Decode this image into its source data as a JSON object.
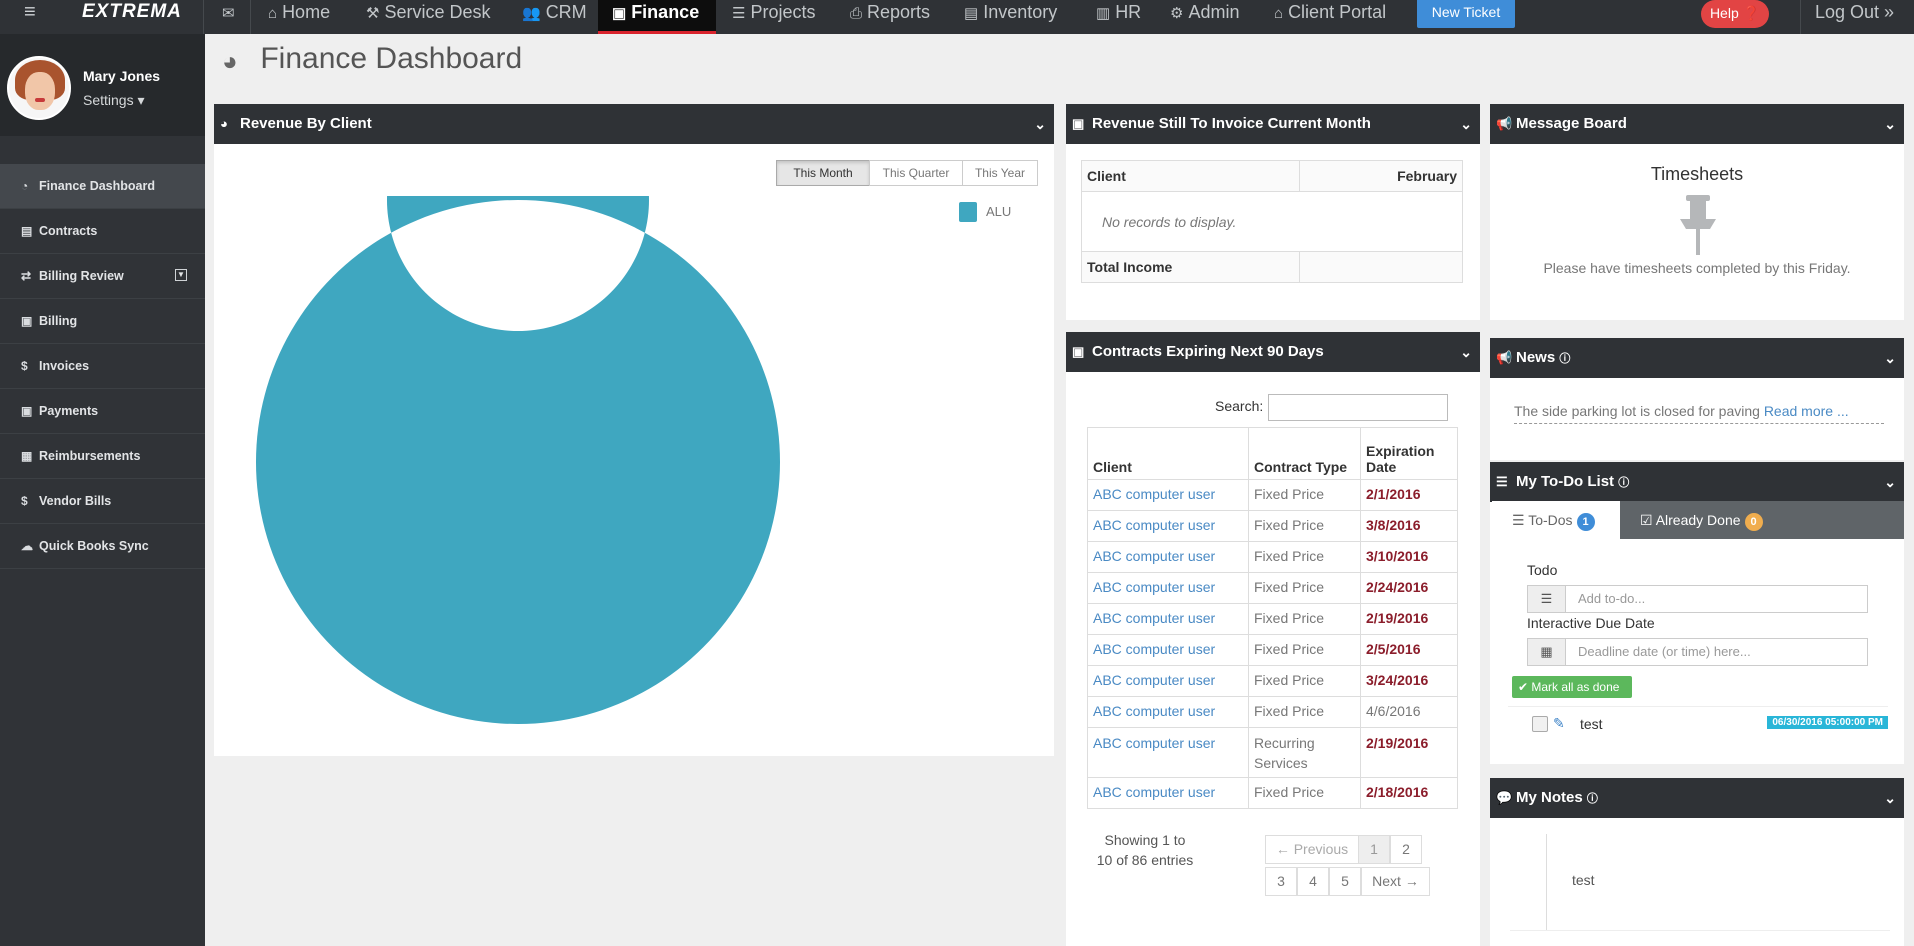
{
  "topnav": {
    "logo": "EXTREMA",
    "items": [
      {
        "label": "",
        "icon": "envelope-icon",
        "glyph": "✉"
      },
      {
        "label": "Home",
        "icon": "home-icon",
        "glyph": "⌂"
      },
      {
        "label": "Service Desk",
        "icon": "wrench-icon",
        "glyph": "⚒"
      },
      {
        "label": "CRM",
        "icon": "users-icon",
        "glyph": "👥"
      },
      {
        "label": "Finance",
        "icon": "money-icon",
        "glyph": "▣"
      },
      {
        "label": "Projects",
        "icon": "tasks-icon",
        "glyph": "☰"
      },
      {
        "label": "Reports",
        "icon": "print-icon",
        "glyph": "⎙"
      },
      {
        "label": "Inventory",
        "icon": "file-icon",
        "glyph": "▤"
      },
      {
        "label": "HR",
        "icon": "briefcase-icon",
        "glyph": "▥"
      },
      {
        "label": "Admin",
        "icon": "gear-icon",
        "glyph": "⚙"
      },
      {
        "label": "Client Portal",
        "icon": "home-icon",
        "glyph": "⌂"
      }
    ],
    "new_ticket": "New Ticket",
    "help": "Help ❓",
    "logout": "Log Out »"
  },
  "user": {
    "name": "Mary Jones",
    "settings": "Settings ▾"
  },
  "sidebar": {
    "items": [
      {
        "label": "Finance Dashboard",
        "icon": "dashboard-icon",
        "glyph": "◔"
      },
      {
        "label": "Contracts",
        "icon": "book-icon",
        "glyph": "▤"
      },
      {
        "label": "Billing Review",
        "icon": "retweet-icon",
        "glyph": "⇄"
      },
      {
        "label": "Billing",
        "icon": "money-icon",
        "glyph": "▣"
      },
      {
        "label": "Invoices",
        "icon": "dollar-icon",
        "glyph": "$"
      },
      {
        "label": "Payments",
        "icon": "money-icon",
        "glyph": "▣"
      },
      {
        "label": "Reimbursements",
        "icon": "calculator-icon",
        "glyph": "▦"
      },
      {
        "label": "Vendor Bills",
        "icon": "dollar-icon",
        "glyph": "$"
      },
      {
        "label": "Quick Books Sync",
        "icon": "cloud-upload-icon",
        "glyph": "☁"
      }
    ]
  },
  "page": {
    "title": "Finance Dashboard"
  },
  "revenue_by_client": {
    "title": "Revenue By Client",
    "tabs": [
      "This Month",
      "This Quarter",
      "This Year"
    ],
    "legend": "ALU"
  },
  "chart_data": {
    "type": "pie",
    "categories": [
      "ALU"
    ],
    "values": [
      100
    ],
    "colors": [
      "#3fa7c0"
    ],
    "title": "",
    "legend_position": "top-right"
  },
  "revenue_invoice": {
    "title": "Revenue Still To Invoice Current Month",
    "col_client": "Client",
    "col_month": "February",
    "empty": "No records to display.",
    "total_label": "Total Income",
    "total_value": ""
  },
  "contracts": {
    "title": "Contracts Expiring Next 90 Days",
    "search_label": "Search:",
    "headers": [
      "Client",
      "Contract Type",
      "Expiration Date"
    ],
    "rows": [
      [
        "ABC computer user",
        "Fixed Price",
        "2/1/2016"
      ],
      [
        "ABC computer user",
        "Fixed Price",
        "3/8/2016"
      ],
      [
        "ABC computer user",
        "Fixed Price",
        "3/10/2016"
      ],
      [
        "ABC computer user",
        "Fixed Price",
        "2/24/2016"
      ],
      [
        "ABC computer user",
        "Fixed Price",
        "2/19/2016"
      ],
      [
        "ABC computer user",
        "Fixed Price",
        "2/5/2016"
      ],
      [
        "ABC computer user",
        "Fixed Price",
        "3/24/2016"
      ],
      [
        "ABC computer user",
        "Fixed Price",
        "4/6/2016"
      ],
      [
        "ABC computer user",
        "Recurring Services",
        "2/19/2016"
      ],
      [
        "ABC computer user",
        "Fixed Price",
        "2/18/2016"
      ]
    ],
    "showing": "Showing 1 to 10 of 86 entries",
    "pagination": {
      "prev": "← Previous",
      "pages": [
        "1",
        "2",
        "3",
        "4",
        "5"
      ],
      "next": "Next →"
    }
  },
  "message_board": {
    "title": "Message Board",
    "heading": "Timesheets",
    "text": "Please have timesheets completed by this Friday."
  },
  "news": {
    "title": "News",
    "text": "The side parking lot is closed for paving ",
    "link": "Read more ..."
  },
  "todo": {
    "title": "My To-Do List",
    "tab_todos": "To-Dos",
    "todos_count": "1",
    "tab_done": "Already Done",
    "done_count": "0",
    "todo_label": "Todo",
    "todo_placeholder": "Add to-do...",
    "due_label": "Interactive Due Date",
    "due_placeholder": "Deadline date (or time) here...",
    "mark_all": "✔ Mark all as done",
    "items": [
      {
        "text": "test",
        "date": "06/30/2016 05:00:00 PM"
      }
    ]
  },
  "notes": {
    "title": "My Notes",
    "text": "test"
  }
}
